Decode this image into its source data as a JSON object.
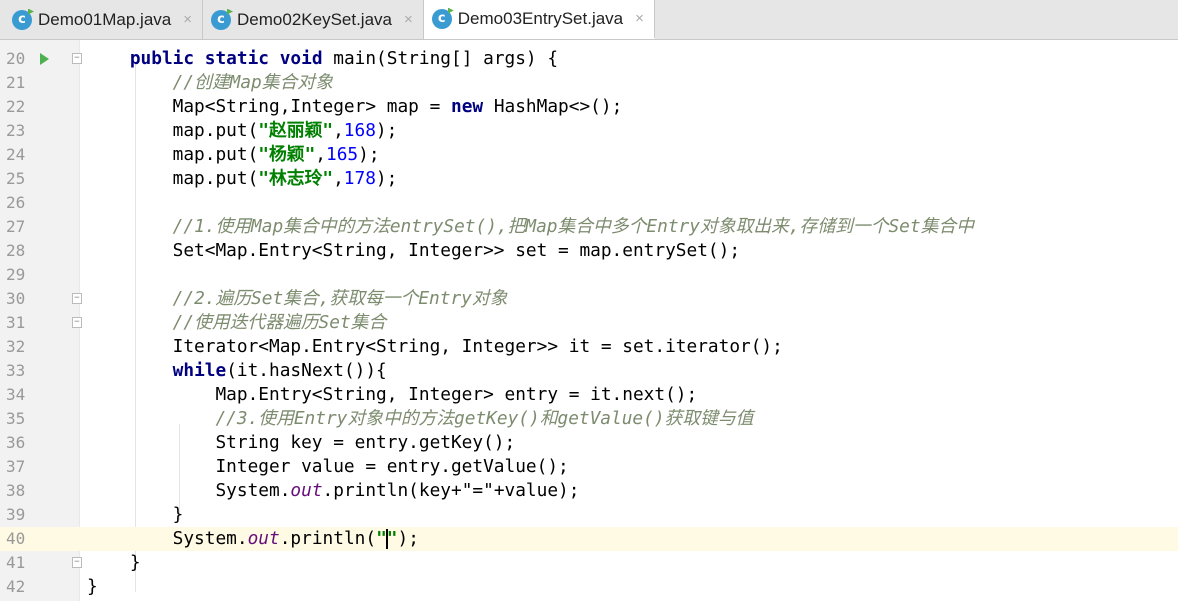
{
  "tabs": [
    {
      "label": "Demo01Map.java",
      "active": false
    },
    {
      "label": "Demo02KeySet.java",
      "active": false
    },
    {
      "label": "Demo03EntrySet.java",
      "active": true
    }
  ],
  "icons": {
    "file": "c",
    "close": "×"
  },
  "current_line": 40,
  "lines": [
    {
      "n": "20",
      "t": [
        [
          "    ",
          ""
        ],
        [
          "public static void ",
          "kw"
        ],
        [
          "main(String[] args) {",
          ""
        ]
      ]
    },
    {
      "n": "21",
      "t": [
        [
          "        ",
          ""
        ],
        [
          "//创建Map集合对象",
          "cm"
        ]
      ]
    },
    {
      "n": "22",
      "t": [
        [
          "        Map<String,Integer> map = ",
          ""
        ],
        [
          "new ",
          "kw"
        ],
        [
          "HashMap<>();",
          ""
        ]
      ]
    },
    {
      "n": "23",
      "t": [
        [
          "        map.put(",
          ""
        ],
        [
          "\"赵丽颖\"",
          "str"
        ],
        [
          ",",
          ""
        ],
        [
          "168",
          "num"
        ],
        [
          ");",
          ""
        ]
      ]
    },
    {
      "n": "24",
      "t": [
        [
          "        map.put(",
          ""
        ],
        [
          "\"杨颖\"",
          "str"
        ],
        [
          ",",
          ""
        ],
        [
          "165",
          "num"
        ],
        [
          ");",
          ""
        ]
      ]
    },
    {
      "n": "25",
      "t": [
        [
          "        map.put(",
          ""
        ],
        [
          "\"林志玲\"",
          "str"
        ],
        [
          ",",
          ""
        ],
        [
          "178",
          "num"
        ],
        [
          ");",
          ""
        ]
      ]
    },
    {
      "n": "26",
      "t": []
    },
    {
      "n": "27",
      "t": [
        [
          "        ",
          ""
        ],
        [
          "//1.使用Map集合中的方法entrySet(),把Map集合中多个Entry对象取出来,存储到一个Set集合中",
          "cm"
        ]
      ]
    },
    {
      "n": "28",
      "t": [
        [
          "        Set<Map.Entry<String, Integer>> set = map.entrySet();",
          ""
        ]
      ]
    },
    {
      "n": "29",
      "t": []
    },
    {
      "n": "30",
      "t": [
        [
          "        ",
          ""
        ],
        [
          "//2.遍历Set集合,获取每一个Entry对象",
          "cm"
        ]
      ]
    },
    {
      "n": "31",
      "t": [
        [
          "        ",
          ""
        ],
        [
          "//使用迭代器遍历Set集合",
          "cm"
        ]
      ]
    },
    {
      "n": "32",
      "t": [
        [
          "        Iterator<Map.Entry<String, Integer>> it = set.iterator();",
          ""
        ]
      ]
    },
    {
      "n": "33",
      "t": [
        [
          "        ",
          ""
        ],
        [
          "while",
          "kw"
        ],
        [
          "(it.hasNext()){",
          ""
        ]
      ]
    },
    {
      "n": "34",
      "t": [
        [
          "            Map.Entry<String, Integer> entry = it.next();",
          ""
        ]
      ]
    },
    {
      "n": "35",
      "t": [
        [
          "            ",
          ""
        ],
        [
          "//3.使用Entry对象中的方法getKey()和getValue()获取键与值",
          "cm"
        ]
      ]
    },
    {
      "n": "36",
      "t": [
        [
          "            String key = entry.getKey();",
          ""
        ]
      ]
    },
    {
      "n": "37",
      "t": [
        [
          "            Integer value = entry.getValue();",
          ""
        ]
      ]
    },
    {
      "n": "38",
      "t": [
        [
          "            System.",
          ""
        ],
        [
          "out",
          "fld"
        ],
        [
          ".println(key+\"=\"+value);",
          ""
        ]
      ]
    },
    {
      "n": "39",
      "t": [
        [
          "        }",
          ""
        ]
      ]
    },
    {
      "n": "40",
      "t": [
        [
          "        System.",
          ""
        ],
        [
          "out",
          "fld"
        ],
        [
          ".println(",
          ""
        ],
        [
          "\"",
          "str"
        ],
        [
          "|caret",
          ""
        ],
        [
          "\"",
          "str"
        ],
        [
          ");",
          ""
        ]
      ]
    },
    {
      "n": "41",
      "t": [
        [
          "    }",
          ""
        ]
      ]
    },
    {
      "n": "42",
      "t": [
        [
          "}",
          ""
        ]
      ]
    }
  ]
}
